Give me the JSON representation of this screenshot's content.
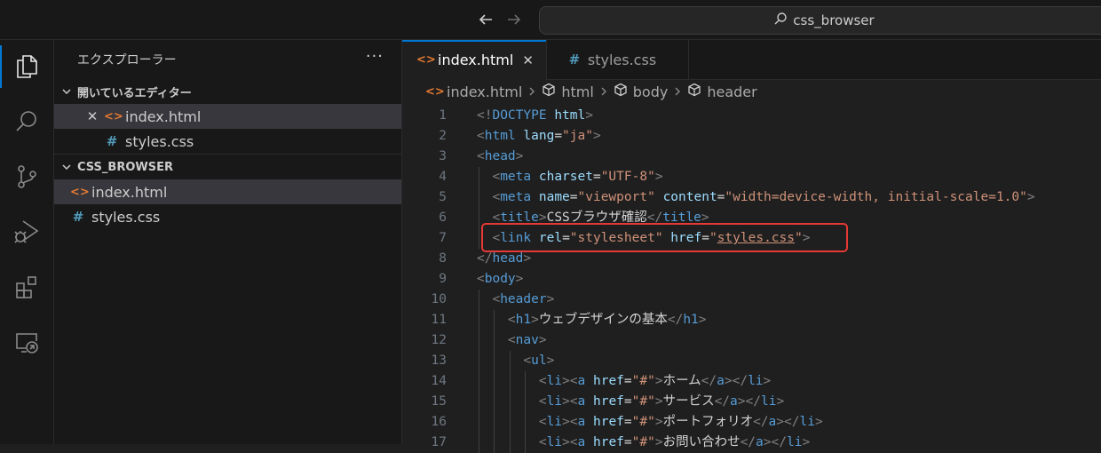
{
  "titlebar": {
    "search_text": "css_browser"
  },
  "activity_bar": {
    "items": [
      "explorer-icon",
      "search-icon",
      "source-control-icon",
      "run-debug-icon",
      "extensions-icon",
      "remote-explorer-icon"
    ]
  },
  "sidebar": {
    "title": "エクスプローラー",
    "more": "···",
    "open_editors": {
      "title": "開いているエディター",
      "files": [
        {
          "name": "index.html",
          "icon": "<>"
        },
        {
          "name": "styles.css",
          "icon": "#"
        }
      ]
    },
    "folder": {
      "title": "CSS_BROWSER",
      "files": [
        {
          "name": "index.html",
          "icon": "<>"
        },
        {
          "name": "styles.css",
          "icon": "#"
        }
      ]
    }
  },
  "tabs": [
    {
      "label": "index.html",
      "icon": "<>",
      "close": "✕"
    },
    {
      "label": "styles.css",
      "icon": "#"
    }
  ],
  "breadcrumb": [
    "index.html",
    "html",
    "body",
    "header"
  ],
  "code_lines": [
    {
      "n": "1",
      "seg": [
        [
          "p",
          "<!"
        ],
        [
          "t",
          "DOCTYPE"
        ],
        [
          "x",
          " "
        ],
        [
          "a",
          "html"
        ],
        [
          "p",
          ">"
        ]
      ]
    },
    {
      "n": "2",
      "seg": [
        [
          "p",
          "<"
        ],
        [
          "t",
          "html"
        ],
        [
          "x",
          " "
        ],
        [
          "a",
          "lang"
        ],
        [
          "x",
          "="
        ],
        [
          "s",
          "\"ja\""
        ],
        [
          "p",
          ">"
        ]
      ]
    },
    {
      "n": "3",
      "seg": [
        [
          "p",
          "<"
        ],
        [
          "t",
          "head"
        ],
        [
          "p",
          ">"
        ]
      ]
    },
    {
      "n": "4",
      "seg": [
        [
          "x",
          "  "
        ],
        [
          "p",
          "<"
        ],
        [
          "t",
          "meta"
        ],
        [
          "x",
          " "
        ],
        [
          "a",
          "charset"
        ],
        [
          "x",
          "="
        ],
        [
          "s",
          "\"UTF-8\""
        ],
        [
          "p",
          ">"
        ]
      ]
    },
    {
      "n": "5",
      "seg": [
        [
          "x",
          "  "
        ],
        [
          "p",
          "<"
        ],
        [
          "t",
          "meta"
        ],
        [
          "x",
          " "
        ],
        [
          "a",
          "name"
        ],
        [
          "x",
          "="
        ],
        [
          "s",
          "\"viewport\""
        ],
        [
          "x",
          " "
        ],
        [
          "a",
          "content"
        ],
        [
          "x",
          "="
        ],
        [
          "s",
          "\"width=device-width, initial-scale=1.0\""
        ],
        [
          "p",
          ">"
        ]
      ]
    },
    {
      "n": "6",
      "seg": [
        [
          "x",
          "  "
        ],
        [
          "p",
          "<"
        ],
        [
          "t",
          "title"
        ],
        [
          "p",
          ">"
        ],
        [
          "x",
          "CSSブラウザ確認"
        ],
        [
          "p",
          "</"
        ],
        [
          "t",
          "title"
        ],
        [
          "p",
          ">"
        ]
      ]
    },
    {
      "n": "7",
      "seg": [
        [
          "x",
          "  "
        ],
        [
          "p",
          "<"
        ],
        [
          "t",
          "link"
        ],
        [
          "x",
          " "
        ],
        [
          "a",
          "rel"
        ],
        [
          "x",
          "="
        ],
        [
          "s",
          "\"stylesheet\""
        ],
        [
          "x",
          " "
        ],
        [
          "a",
          "href"
        ],
        [
          "x",
          "="
        ],
        [
          "s",
          "\""
        ],
        [
          "su",
          "styles.css"
        ],
        [
          "s",
          "\""
        ],
        [
          "p",
          ">"
        ]
      ]
    },
    {
      "n": "8",
      "seg": [
        [
          "p",
          "</"
        ],
        [
          "t",
          "head"
        ],
        [
          "p",
          ">"
        ]
      ]
    },
    {
      "n": "9",
      "seg": [
        [
          "p",
          "<"
        ],
        [
          "t",
          "body"
        ],
        [
          "p",
          ">"
        ]
      ]
    },
    {
      "n": "10",
      "seg": [
        [
          "x",
          "  "
        ],
        [
          "p",
          "<"
        ],
        [
          "t",
          "header"
        ],
        [
          "p",
          ">"
        ]
      ]
    },
    {
      "n": "11",
      "seg": [
        [
          "x",
          "    "
        ],
        [
          "p",
          "<"
        ],
        [
          "t",
          "h1"
        ],
        [
          "p",
          ">"
        ],
        [
          "x",
          "ウェブデザインの基本"
        ],
        [
          "p",
          "</"
        ],
        [
          "t",
          "h1"
        ],
        [
          "p",
          ">"
        ]
      ]
    },
    {
      "n": "12",
      "seg": [
        [
          "x",
          "    "
        ],
        [
          "p",
          "<"
        ],
        [
          "t",
          "nav"
        ],
        [
          "p",
          ">"
        ]
      ]
    },
    {
      "n": "13",
      "seg": [
        [
          "x",
          "      "
        ],
        [
          "p",
          "<"
        ],
        [
          "t",
          "ul"
        ],
        [
          "p",
          ">"
        ]
      ]
    },
    {
      "n": "14",
      "seg": [
        [
          "x",
          "        "
        ],
        [
          "p",
          "<"
        ],
        [
          "t",
          "li"
        ],
        [
          "p",
          "><"
        ],
        [
          "t",
          "a"
        ],
        [
          "x",
          " "
        ],
        [
          "a",
          "href"
        ],
        [
          "x",
          "="
        ],
        [
          "s",
          "\"#\""
        ],
        [
          "p",
          ">"
        ],
        [
          "x",
          "ホーム"
        ],
        [
          "p",
          "</"
        ],
        [
          "t",
          "a"
        ],
        [
          "p",
          "></"
        ],
        [
          "t",
          "li"
        ],
        [
          "p",
          ">"
        ]
      ]
    },
    {
      "n": "15",
      "seg": [
        [
          "x",
          "        "
        ],
        [
          "p",
          "<"
        ],
        [
          "t",
          "li"
        ],
        [
          "p",
          "><"
        ],
        [
          "t",
          "a"
        ],
        [
          "x",
          " "
        ],
        [
          "a",
          "href"
        ],
        [
          "x",
          "="
        ],
        [
          "s",
          "\"#\""
        ],
        [
          "p",
          ">"
        ],
        [
          "x",
          "サービス"
        ],
        [
          "p",
          "</"
        ],
        [
          "t",
          "a"
        ],
        [
          "p",
          "></"
        ],
        [
          "t",
          "li"
        ],
        [
          "p",
          ">"
        ]
      ]
    },
    {
      "n": "16",
      "seg": [
        [
          "x",
          "        "
        ],
        [
          "p",
          "<"
        ],
        [
          "t",
          "li"
        ],
        [
          "p",
          "><"
        ],
        [
          "t",
          "a"
        ],
        [
          "x",
          " "
        ],
        [
          "a",
          "href"
        ],
        [
          "x",
          "="
        ],
        [
          "s",
          "\"#\""
        ],
        [
          "p",
          ">"
        ],
        [
          "x",
          "ポートフォリオ"
        ],
        [
          "p",
          "</"
        ],
        [
          "t",
          "a"
        ],
        [
          "p",
          "></"
        ],
        [
          "t",
          "li"
        ],
        [
          "p",
          ">"
        ]
      ]
    },
    {
      "n": "17",
      "seg": [
        [
          "x",
          "        "
        ],
        [
          "p",
          "<"
        ],
        [
          "t",
          "li"
        ],
        [
          "p",
          "><"
        ],
        [
          "t",
          "a"
        ],
        [
          "x",
          " "
        ],
        [
          "a",
          "href"
        ],
        [
          "x",
          "="
        ],
        [
          "s",
          "\"#\""
        ],
        [
          "p",
          ">"
        ],
        [
          "x",
          "お問い合わせ"
        ],
        [
          "p",
          "</"
        ],
        [
          "t",
          "a"
        ],
        [
          "p",
          "></"
        ],
        [
          "t",
          "li"
        ],
        [
          "p",
          ">"
        ]
      ]
    }
  ],
  "colors": {
    "accent": "#0078d4",
    "highlight_box": "#e53935",
    "tag": "#569cd6",
    "attribute": "#9cdcfe",
    "string": "#ce9178",
    "punctuation": "#808080"
  }
}
